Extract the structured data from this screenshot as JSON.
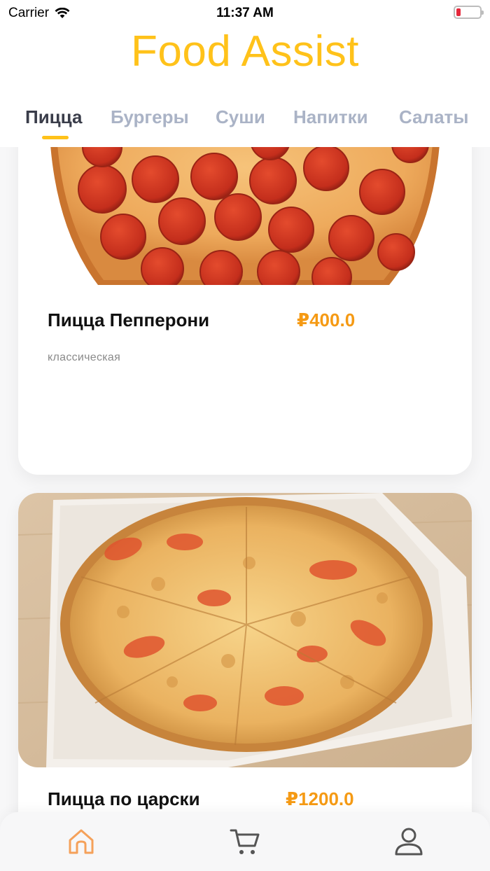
{
  "status": {
    "carrier": "Carrier",
    "time": "11:37 AM"
  },
  "header": {
    "title": "Food Assist"
  },
  "tabs": [
    {
      "label": "Пицца",
      "active": true
    },
    {
      "label": "Бургеры",
      "active": false
    },
    {
      "label": "Суши",
      "active": false
    },
    {
      "label": "Напитки",
      "active": false
    },
    {
      "label": "Салаты",
      "active": false
    }
  ],
  "products": [
    {
      "name": "Пицца Пепперони",
      "price": "₽400.0",
      "description": "классическая"
    },
    {
      "name": "Пицца по царски",
      "price": "₽1200.0"
    }
  ],
  "bottom_nav": [
    {
      "icon": "home-icon",
      "active": true
    },
    {
      "icon": "cart-icon",
      "active": false
    },
    {
      "icon": "user-icon",
      "active": false
    }
  ],
  "colors": {
    "accent": "#ffc21a",
    "price": "#f59a14",
    "nav_active": "#f5a15a",
    "nav_inactive": "#555555"
  }
}
